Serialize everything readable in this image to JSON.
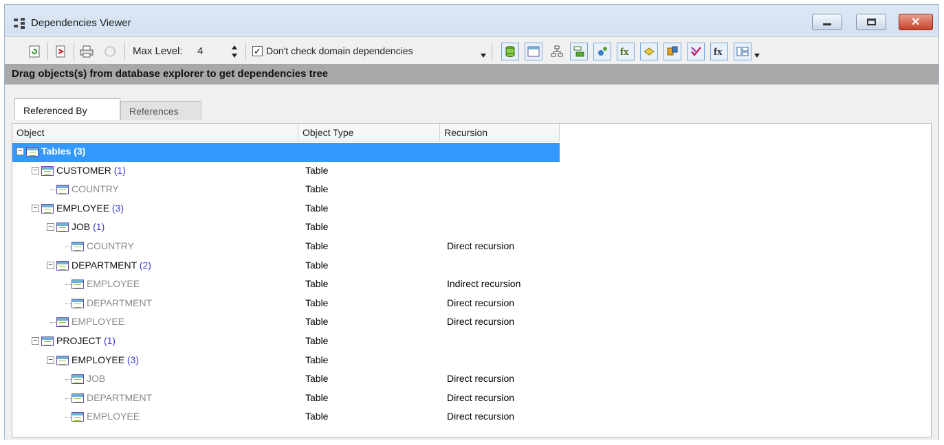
{
  "window": {
    "title": "Dependencies Viewer"
  },
  "toolbar": {
    "max_level_label": "Max Level:",
    "max_level_value": "4",
    "domain_check_label": "Don't check domain dependencies",
    "domain_check_checked": true
  },
  "hint": "Drag objects(s) from database explorer to get dependencies tree",
  "tabs": [
    {
      "label": "Referenced By",
      "active": true
    },
    {
      "label": "References",
      "active": false
    }
  ],
  "columns": [
    "Object",
    "Object Type",
    "Recursion"
  ],
  "rows": [
    {
      "name": "Tables",
      "count": "(3)",
      "type": "",
      "recursion": "",
      "level": 0,
      "expanded": true,
      "selected": true
    },
    {
      "name": "CUSTOMER",
      "count": "(1)",
      "type": "Table",
      "recursion": "",
      "level": 1,
      "expanded": true
    },
    {
      "name": "COUNTRY",
      "count": "",
      "type": "Table",
      "recursion": "",
      "level": 2,
      "leaf": true
    },
    {
      "name": "EMPLOYEE",
      "count": "(3)",
      "type": "Table",
      "recursion": "",
      "level": 1,
      "expanded": true
    },
    {
      "name": "JOB",
      "count": "(1)",
      "type": "Table",
      "recursion": "",
      "level": 2,
      "expanded": true
    },
    {
      "name": "COUNTRY",
      "count": "",
      "type": "Table",
      "recursion": "Direct recursion",
      "level": 3,
      "leaf": true
    },
    {
      "name": "DEPARTMENT",
      "count": "(2)",
      "type": "Table",
      "recursion": "",
      "level": 2,
      "expanded": true
    },
    {
      "name": "EMPLOYEE",
      "count": "",
      "type": "Table",
      "recursion": "Indirect recursion",
      "level": 3,
      "leaf": true
    },
    {
      "name": "DEPARTMENT",
      "count": "",
      "type": "Table",
      "recursion": "Direct recursion",
      "level": 3,
      "leaf": true
    },
    {
      "name": "EMPLOYEE",
      "count": "",
      "type": "Table",
      "recursion": "Direct recursion",
      "level": 2,
      "leaf": true
    },
    {
      "name": "PROJECT",
      "count": "(1)",
      "type": "Table",
      "recursion": "",
      "level": 1,
      "expanded": true
    },
    {
      "name": "EMPLOYEE",
      "count": "(3)",
      "type": "Table",
      "recursion": "",
      "level": 2,
      "expanded": true
    },
    {
      "name": "JOB",
      "count": "",
      "type": "Table",
      "recursion": "Direct recursion",
      "level": 3,
      "leaf": true
    },
    {
      "name": "DEPARTMENT",
      "count": "",
      "type": "Table",
      "recursion": "Direct recursion",
      "level": 3,
      "leaf": true
    },
    {
      "name": "EMPLOYEE",
      "count": "",
      "type": "Table",
      "recursion": "Direct recursion",
      "level": 3,
      "leaf": true
    }
  ],
  "icons": {
    "toolbar_left": [
      "refresh-icon",
      "export-icon",
      "print-icon",
      "stop-icon"
    ],
    "toolbar_right": [
      "database-icon",
      "table-icon",
      "tree-view-icon",
      "domains-icon",
      "generators-icon",
      "functions-icon",
      "packages-icon",
      "procedures-icon",
      "exceptions-icon",
      "udf-icon",
      "layout-icon"
    ]
  },
  "colors": {
    "selection": "#3399ff",
    "count": "#3b3bd8",
    "leaf_text": "#8a8a8a",
    "hint_bar": "#a8a8a8"
  }
}
